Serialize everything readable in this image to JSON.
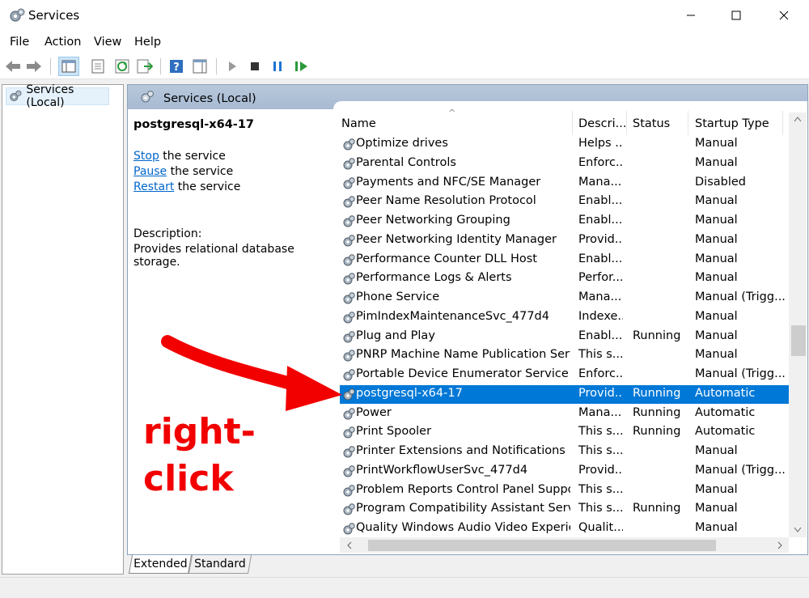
{
  "window": {
    "title": "Services"
  },
  "menu": [
    "File",
    "Action",
    "View",
    "Help"
  ],
  "tree": {
    "root_label": "Services (Local)"
  },
  "main": {
    "header_label": "Services (Local)",
    "selected_service": "postgresql-x64-17",
    "actions": [
      {
        "link": "Stop",
        "rest": " the service"
      },
      {
        "link": "Pause",
        "rest": " the service"
      },
      {
        "link": "Restart",
        "rest": " the service"
      }
    ],
    "description_label": "Description:",
    "description_text": "Provides relational database storage."
  },
  "columns": {
    "name": "Name",
    "description": "Descri...",
    "status": "Status",
    "startup": "Startup Type"
  },
  "rows": [
    {
      "name": "Optimize drives",
      "desc": "Helps ...",
      "status": "",
      "startup": "Manual"
    },
    {
      "name": "Parental Controls",
      "desc": "Enforc...",
      "status": "",
      "startup": "Manual"
    },
    {
      "name": "Payments and NFC/SE Manager",
      "desc": "Mana...",
      "status": "",
      "startup": "Disabled"
    },
    {
      "name": "Peer Name Resolution Protocol",
      "desc": "Enabl...",
      "status": "",
      "startup": "Manual"
    },
    {
      "name": "Peer Networking Grouping",
      "desc": "Enabl...",
      "status": "",
      "startup": "Manual"
    },
    {
      "name": "Peer Networking Identity Manager",
      "desc": "Provid...",
      "status": "",
      "startup": "Manual"
    },
    {
      "name": "Performance Counter DLL Host",
      "desc": "Enabl...",
      "status": "",
      "startup": "Manual"
    },
    {
      "name": "Performance Logs & Alerts",
      "desc": "Perfor...",
      "status": "",
      "startup": "Manual"
    },
    {
      "name": "Phone Service",
      "desc": "Mana...",
      "status": "",
      "startup": "Manual (Trigg..."
    },
    {
      "name": "PimIndexMaintenanceSvc_477d4",
      "desc": "Indexe...",
      "status": "",
      "startup": "Manual"
    },
    {
      "name": "Plug and Play",
      "desc": "Enabl...",
      "status": "Running",
      "startup": "Manual"
    },
    {
      "name": "PNRP Machine Name Publication Service",
      "desc": "This s...",
      "status": "",
      "startup": "Manual"
    },
    {
      "name": "Portable Device Enumerator Service",
      "desc": "Enforc...",
      "status": "",
      "startup": "Manual (Trigg..."
    },
    {
      "name": "postgresql-x64-17",
      "desc": "Provid...",
      "status": "Running",
      "startup": "Automatic",
      "selected": true
    },
    {
      "name": "Power",
      "desc": "Mana...",
      "status": "Running",
      "startup": "Automatic"
    },
    {
      "name": "Print Spooler",
      "desc": "This s...",
      "status": "Running",
      "startup": "Automatic"
    },
    {
      "name": "Printer Extensions and Notifications",
      "desc": "This s...",
      "status": "",
      "startup": "Manual"
    },
    {
      "name": "PrintWorkflowUserSvc_477d4",
      "desc": "Provid...",
      "status": "",
      "startup": "Manual (Trigg..."
    },
    {
      "name": "Problem Reports Control Panel Support",
      "desc": "This s...",
      "status": "",
      "startup": "Manual"
    },
    {
      "name": "Program Compatibility Assistant Service",
      "desc": "This s...",
      "status": "Running",
      "startup": "Manual"
    },
    {
      "name": "Quality Windows Audio Video Experien...",
      "desc": "Qualit...",
      "status": "",
      "startup": "Manual"
    }
  ],
  "tabs": {
    "extended": "Extended",
    "standard": "Standard"
  },
  "annotation": {
    "line1": "right-",
    "line2": "click",
    "color": "#f20000"
  },
  "colors": {
    "selection": "#0078d7",
    "link": "#0066cc"
  }
}
